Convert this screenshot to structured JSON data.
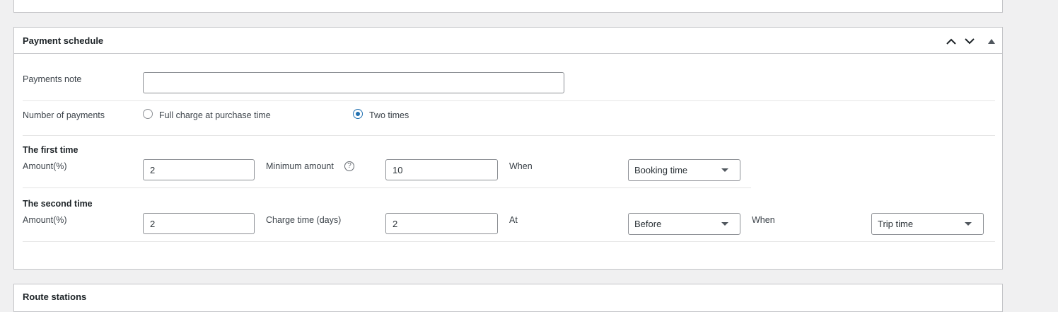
{
  "panel": {
    "title": "Payment schedule",
    "header_icons": [
      "chevron-up-icon",
      "chevron-down-icon",
      "triangle-up-icon"
    ]
  },
  "payments_note": {
    "label": "Payments note",
    "value": ""
  },
  "number_of_payments": {
    "label": "Number of payments",
    "options": [
      {
        "label": "Full charge at purchase time",
        "checked": false
      },
      {
        "label": "Two times",
        "checked": true
      }
    ]
  },
  "first_time": {
    "heading": "The first time",
    "amount_label": "Amount(%)",
    "amount_value": "2",
    "min_label": "Minimum amount",
    "help_glyph": "?",
    "min_value": "10",
    "when_label": "When",
    "when_value": "Booking time"
  },
  "second_time": {
    "heading": "The second time",
    "amount_label": "Amount(%)",
    "amount_value": "2",
    "charge_label": "Charge time (days)",
    "charge_value": "2",
    "at_label": "At",
    "at_value": "Before",
    "when_label": "When",
    "when_value": "Trip time"
  },
  "next_panel": {
    "title": "Route stations"
  },
  "colors": {
    "accent": "#2271b1",
    "border": "#c3c4c7",
    "background": "#f0f0f1"
  }
}
